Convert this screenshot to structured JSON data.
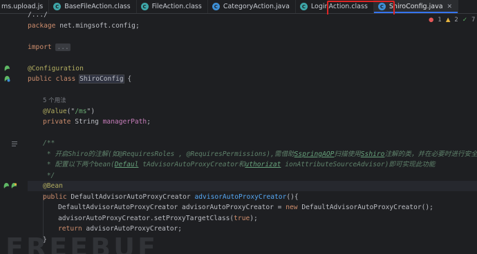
{
  "tabs": [
    {
      "label": "ms.upload.js",
      "icon": "js-file-icon",
      "active": false
    },
    {
      "label": "BaseFileAction.class",
      "icon": "class-file-icon",
      "active": false
    },
    {
      "label": "FileAction.class",
      "icon": "class-file-icon",
      "active": false
    },
    {
      "label": "CategoryAction.java",
      "icon": "java-file-icon",
      "active": false
    },
    {
      "label": "LoginAction.class",
      "icon": "class-file-icon",
      "active": false
    },
    {
      "label": "ShiroConfig.java",
      "icon": "java-file-icon",
      "active": true
    }
  ],
  "inspections": {
    "errors": "1",
    "warnings": "2",
    "ok": "7"
  },
  "code": {
    "l1": "/.../",
    "package_kw": "package",
    "package_name": " net.mingsoft.config;",
    "import_kw": "import",
    "import_fold": "...",
    "ann_configuration": "@Configuration",
    "public": "public",
    "class": "class",
    "class_name": "ShiroConfig",
    "brace_open": " {",
    "usage_hint": "5 个用法",
    "ann_value": "@Value",
    "value_open": "(\"",
    "value_str": "/ms",
    "value_close": "\")",
    "private": "private",
    "string_type": " String ",
    "field_name": "managerPath",
    "semicolon": ";",
    "doc_start": "/**",
    "doc_line1_a": " * 开启",
    "doc_line1_shiro": "Shiro",
    "doc_line1_b": "的注解(如",
    "doc_line1_c": "@RequiresRoles",
    "doc_line1_d": " , ",
    "doc_line1_e": "@RequiresPermissions",
    "doc_line1_f": "),需借助",
    "doc_line1_g": "SspringAOP",
    "doc_line1_h": "扫描使用",
    "doc_line1_i": "Sshiro",
    "doc_line1_j": "注解的类，并在必要时进行安全逻辑验",
    "doc_line2_a": " * 配置以下两个",
    "doc_line2_b": "bean(",
    "doc_line2_c": "Defaul",
    "doc_line2_d": " tAdvisorAutoProxyCreator",
    "doc_line2_e": "和",
    "doc_line2_f": "uthorizat",
    "doc_line2_g": " ionAttributeSourceAdvisor",
    "doc_line2_h": ")即可实现此功能",
    "doc_end": " */",
    "ann_bean": "@Bean",
    "method_type": " DefaultAdvisorAutoProxyCreator ",
    "method_name": "advisorAutoProxyCreator",
    "method_sig_end": "(){",
    "body1_a": "DefaultAdvisorAutoProxyCreator advisorAutoProxyCreator = ",
    "body1_new": "new",
    "body1_b": " DefaultAdvisorAutoProxyCreator();",
    "body2_a": "advisorAutoProxyCreator.setProxyTargetClass(",
    "body2_true": "true",
    "body2_b": ");",
    "return_kw": "return",
    "return_val": " advisorAutoProxyCreator;",
    "brace_close": "}"
  },
  "watermark": "FREEBUF"
}
